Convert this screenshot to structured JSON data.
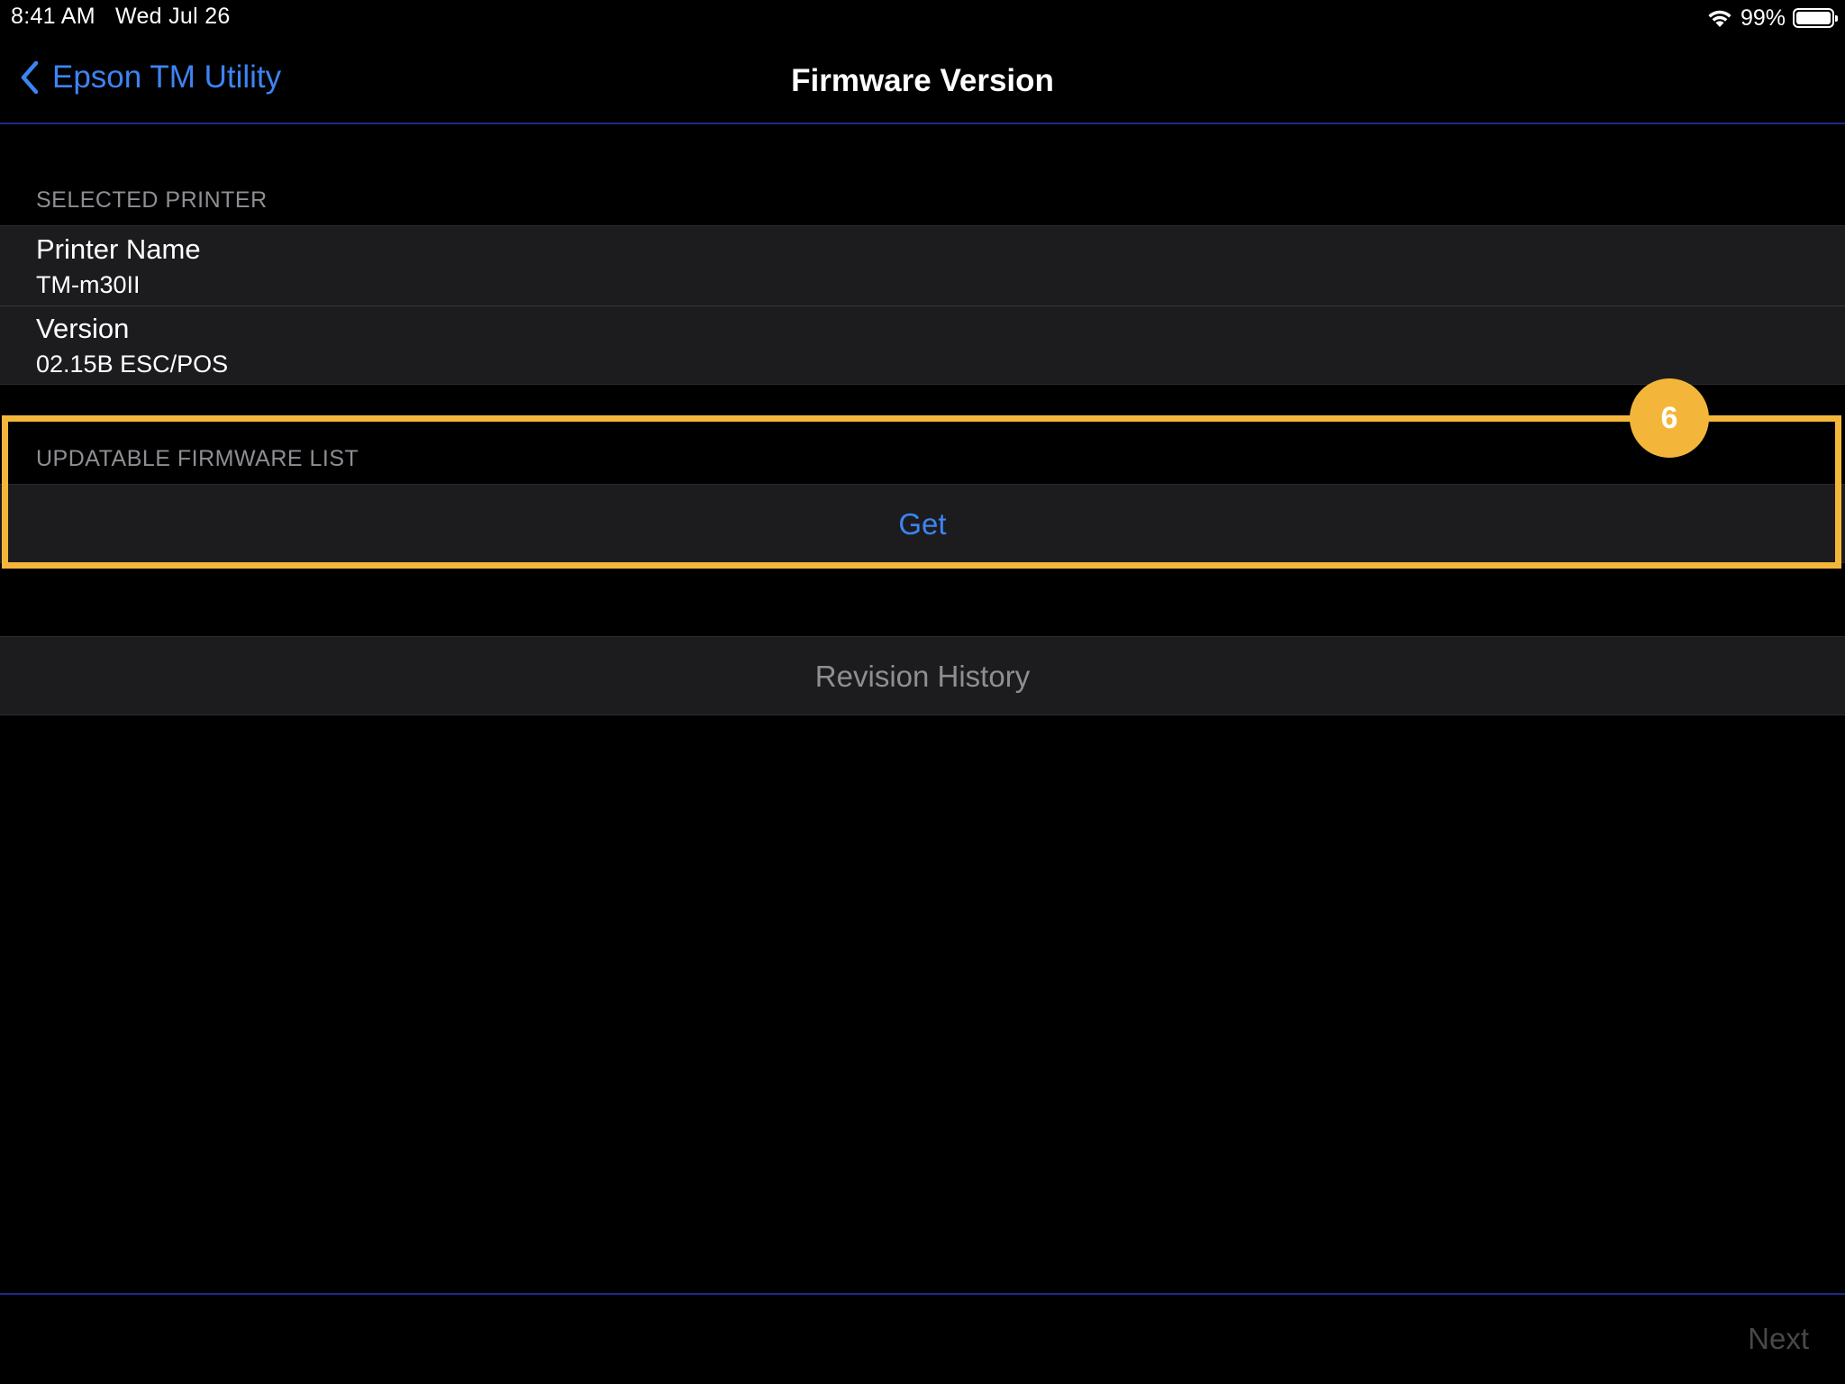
{
  "status_bar": {
    "time": "8:41 AM",
    "date": "Wed Jul 26",
    "battery_percent_label": "99%",
    "battery_level": 0.99,
    "icons": [
      "wifi-icon",
      "battery-icon"
    ]
  },
  "nav": {
    "back_label": "Epson TM Utility",
    "back_icon": "chevron-left-icon",
    "title": "Firmware Version"
  },
  "selected_printer": {
    "header": "SELECTED PRINTER",
    "rows": [
      {
        "title": "Printer Name",
        "value": "TM-m30II"
      },
      {
        "title": "Version",
        "value": "02.15B ESC/POS"
      }
    ]
  },
  "updatable_firmware": {
    "header": "UPDATABLE FIRMWARE LIST",
    "action_label": "Get"
  },
  "revision_history": {
    "label": "Revision History"
  },
  "annotation": {
    "step_number": "6",
    "color": "#f4b63a"
  },
  "toolbar": {
    "next_label": "Next"
  },
  "colors": {
    "background": "#000000",
    "cell_background": "#1c1c1e",
    "accent_blue": "#3d84f3",
    "separator_blue": "#1d2a8c",
    "secondary_text": "#8e8e93",
    "disabled_text": "#48484a"
  }
}
